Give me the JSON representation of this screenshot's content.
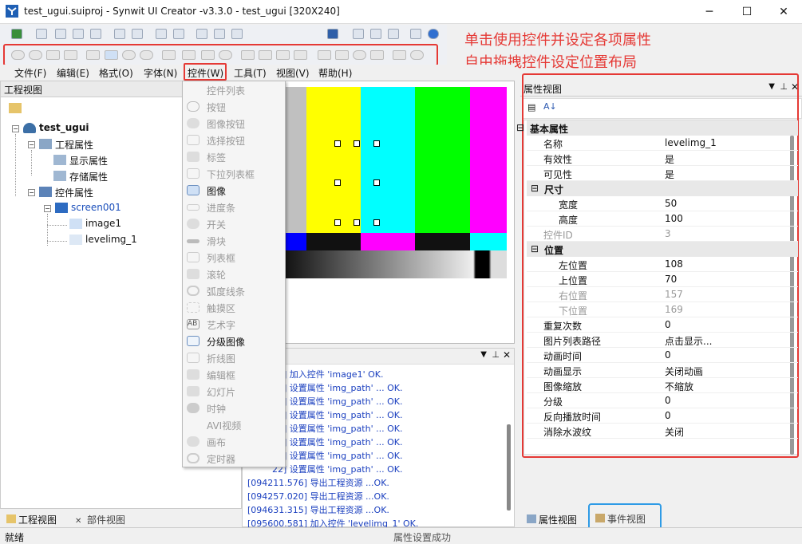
{
  "window": {
    "title": "test_ugui.suiproj - Synwit UI Creator -v3.3.0 - test_ugui [320X240]",
    "minimize": "─",
    "maximize": "☐",
    "close": "✕"
  },
  "annotations": {
    "line1": "单击使用控件并设定各项属性",
    "line2": "自由拖拽控件设定位置布局"
  },
  "menubar": {
    "items": [
      "文件(F)",
      "编辑(E)",
      "格式(O)",
      "字体(N)",
      "控件(W)",
      "工具(T)",
      "视图(V)",
      "帮助(H)"
    ]
  },
  "project_panel": {
    "title": "工程视图",
    "tree": {
      "root": "test_ugui",
      "project_props": "工程属性",
      "display_props": "显示属性",
      "storage_props": "存储属性",
      "control_props": "控件属性",
      "screen": "screen001",
      "image1": "image1",
      "levelimg": "levelimg_1"
    }
  },
  "control_menu": {
    "items": [
      {
        "label": "控件列表",
        "enabled": false
      },
      {
        "label": "按钮",
        "enabled": false,
        "icon": "button-icon"
      },
      {
        "label": "图像按钮",
        "enabled": false,
        "icon": "image-button-icon"
      },
      {
        "label": "选择按钮",
        "enabled": false,
        "icon": "checkbox-icon"
      },
      {
        "label": "标签",
        "enabled": false,
        "icon": "label-icon"
      },
      {
        "label": "下拉列表框",
        "enabled": false,
        "icon": "dropdown-icon"
      },
      {
        "label": "图像",
        "enabled": true,
        "icon": "image-icon"
      },
      {
        "label": "进度条",
        "enabled": false,
        "icon": "progress-icon"
      },
      {
        "label": "开关",
        "enabled": false,
        "icon": "switch-icon"
      },
      {
        "label": "滑块",
        "enabled": false,
        "icon": "slider-icon"
      },
      {
        "label": "列表框",
        "enabled": false,
        "icon": "listbox-icon"
      },
      {
        "label": "滚轮",
        "enabled": false,
        "icon": "roller-icon"
      },
      {
        "label": "弧度线条",
        "enabled": false,
        "icon": "arc-icon"
      },
      {
        "label": "触摸区",
        "enabled": false,
        "icon": "touch-icon"
      },
      {
        "label": "艺术字",
        "enabled": false,
        "icon": "art-text-icon"
      },
      {
        "label": "分级图像",
        "enabled": true,
        "icon": "level-image-icon"
      },
      {
        "label": "折线图",
        "enabled": false,
        "icon": "line-chart-icon"
      },
      {
        "label": "编辑框",
        "enabled": false,
        "icon": "edit-icon"
      },
      {
        "label": "幻灯片",
        "enabled": false,
        "icon": "slideshow-icon"
      },
      {
        "label": "时钟",
        "enabled": false,
        "icon": "clock-icon"
      },
      {
        "label": "AVI视频",
        "enabled": false,
        "icon": "video-icon"
      },
      {
        "label": "画布",
        "enabled": false,
        "icon": "canvas-icon"
      },
      {
        "label": "定时器",
        "enabled": false,
        "icon": "timer-icon"
      }
    ]
  },
  "log": {
    "lines": [
      "59] 加入控件 'image1' OK.",
      "78] 设置属性 'img_path' ... OK.",
      "02] 设置属性 'img_path' ... OK.",
      "51] 设置属性 'img_path' ... OK.",
      "09] 设置属性 'img_path' ... OK.",
      "32] 设置属性 'img_path' ... OK.",
      "82] 设置属性 'img_path' ... OK.",
      "22] 设置属性 'img_path' ... OK.",
      "[094211.576] 导出工程资源 ...OK.",
      "[094257.020] 导出工程资源 ...OK.",
      "[094631.315] 导出工程资源 ...OK.",
      "[095600.581] 加入控件 'levelimg_1' OK."
    ]
  },
  "prop_panel": {
    "title": "属性视图",
    "rows": [
      {
        "name": "基本属性",
        "value": "",
        "group": true,
        "indent": 0
      },
      {
        "name": "名称",
        "value": "levelimg_1",
        "indent": 0
      },
      {
        "name": "有效性",
        "value": "是",
        "indent": 0
      },
      {
        "name": "可见性",
        "value": "是",
        "indent": 0
      },
      {
        "name": "尺寸",
        "value": "",
        "group": true,
        "indent": 1
      },
      {
        "name": "宽度",
        "value": "50",
        "indent": 1
      },
      {
        "name": "高度",
        "value": "100",
        "indent": 1
      },
      {
        "name": "控件ID",
        "value": "3",
        "disabled": true,
        "indent": 0
      },
      {
        "name": "位置",
        "value": "",
        "group": true,
        "indent": 1
      },
      {
        "name": "左位置",
        "value": "108",
        "indent": 1
      },
      {
        "name": "上位置",
        "value": "70",
        "indent": 1
      },
      {
        "name": "右位置",
        "value": "157",
        "disabled": true,
        "indent": 1
      },
      {
        "name": "下位置",
        "value": "169",
        "disabled": true,
        "indent": 1
      },
      {
        "name": "重复次数",
        "value": "0",
        "indent": 0
      },
      {
        "name": "图片列表路径",
        "value": "点击显示...",
        "indent": 0
      },
      {
        "name": "动画时间",
        "value": "0",
        "indent": 0
      },
      {
        "name": "动画显示",
        "value": "关闭动画",
        "indent": 0
      },
      {
        "name": "图像缩放",
        "value": "不缩放",
        "indent": 0
      },
      {
        "name": "分级",
        "value": "0",
        "indent": 0
      },
      {
        "name": "反向播放时间",
        "value": "0",
        "indent": 0
      },
      {
        "name": "消除水波纹",
        "value": "关闭",
        "indent": 0
      }
    ]
  },
  "tabs": {
    "project": "工程视图",
    "components": "部件视图",
    "properties": "属性视图",
    "events": "事件视图"
  },
  "status": {
    "left": "就绪",
    "center": "属性设置成功"
  },
  "colors": {
    "accent_red": "#e53935",
    "accent_blue": "#2e9be6",
    "log_blue": "#1a3fbf"
  }
}
